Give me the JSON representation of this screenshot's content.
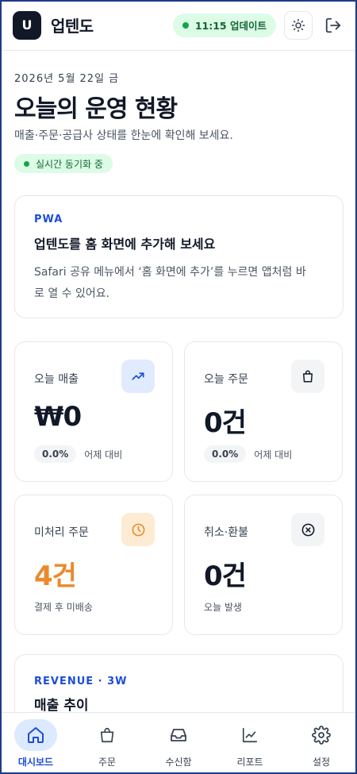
{
  "header": {
    "logo_letter": "U",
    "brand": "업텐도",
    "update_status": "11:15 업데이트"
  },
  "hero": {
    "date": "2026년 5월 22일 금",
    "title": "오늘의 운영 현황",
    "subtitle": "매출·주문·공급사 상태를 한눈에 확인해 보세요.",
    "live_status": "실시간 동기화 중"
  },
  "pwa_card": {
    "eyebrow": "PWA",
    "title": "업텐도를 홈 화면에 추가해 보세요",
    "desc_line1": "Safari 공유 메뉴에서 ‘홈 화면에 추가’를 누르면 앱처럼 바",
    "desc_line2": "로 열 수 있어요."
  },
  "stats": {
    "sales": {
      "label": "오늘 매출",
      "value": "₩0",
      "pct": "0.0%",
      "compare": "어제 대비",
      "icon": "trending-up-icon"
    },
    "orders": {
      "label": "오늘 주문",
      "value": "0건",
      "pct": "0.0%",
      "compare": "어제 대비",
      "icon": "shopping-bag-icon"
    },
    "pending": {
      "label": "미처리 주문",
      "value": "4건",
      "sub": "결제 후 미배송",
      "icon": "clock-icon"
    },
    "cancel": {
      "label": "취소·환불",
      "value": "0건",
      "sub": "오늘 발생",
      "icon": "x-circle-icon"
    }
  },
  "trend": {
    "eyebrow": "REVENUE · 3W",
    "title": "매출 추이"
  },
  "nav": {
    "items": [
      {
        "label": "대시보드",
        "icon": "home-icon",
        "active": true
      },
      {
        "label": "주문",
        "icon": "shopping-bag-icon",
        "active": false
      },
      {
        "label": "수신함",
        "icon": "inbox-icon",
        "active": false
      },
      {
        "label": "리포트",
        "icon": "chart-line-icon",
        "active": false
      },
      {
        "label": "설정",
        "icon": "gear-icon",
        "active": false
      }
    ]
  },
  "colors": {
    "accent": "#1d4ed8",
    "success_bg": "#dcfce7",
    "success_text": "#166534",
    "warning": "#ea8a2b"
  }
}
